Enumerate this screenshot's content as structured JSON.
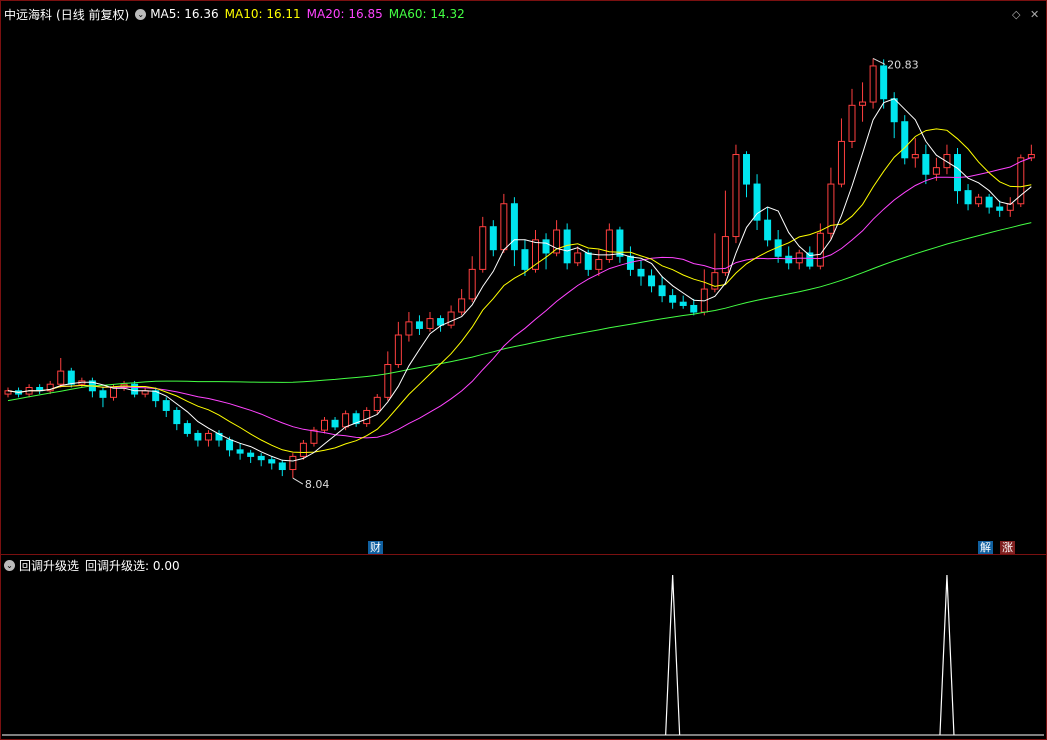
{
  "main_panel": {
    "stock_name": "中远海科",
    "period_label": "(日线 前复权)",
    "ma_items": [
      {
        "label": "MA5: 16.36",
        "color": "#ffffff"
      },
      {
        "label": "MA10: 16.11",
        "color": "#ffff00"
      },
      {
        "label": "MA20: 16.85",
        "color": "#ff44ff"
      },
      {
        "label": "MA60: 14.32",
        "color": "#44ff44"
      }
    ],
    "high_label": "20.83",
    "low_label": "8.04",
    "tags": {
      "cai": "财",
      "jie": "解",
      "zhang": "涨"
    },
    "window_icons": {
      "diamond": "◇",
      "close": "✕"
    }
  },
  "indicator_panel": {
    "name": "回调升级选",
    "value_label": "回调升级选: 0.00"
  },
  "colors": {
    "up": "#ff4040",
    "down": "#00e5ee",
    "ma5": "#ffffff",
    "ma10": "#ffff00",
    "ma20": "#ff44ff",
    "ma60": "#44ff44",
    "border": "#7a1010"
  },
  "chart_data": {
    "type": "candlestick",
    "price_range": [
      6.0,
      22.0
    ],
    "candles": [
      [
        10.6,
        10.7,
        10.8,
        10.5
      ],
      [
        10.7,
        10.6,
        10.8,
        10.5
      ],
      [
        10.6,
        10.8,
        10.9,
        10.5
      ],
      [
        10.8,
        10.7,
        10.9,
        10.6
      ],
      [
        10.7,
        10.9,
        11.0,
        10.6
      ],
      [
        10.9,
        11.3,
        11.7,
        10.8
      ],
      [
        11.3,
        10.9,
        11.4,
        10.8
      ],
      [
        10.9,
        11.0,
        11.1,
        10.8
      ],
      [
        11.0,
        10.7,
        11.1,
        10.5
      ],
      [
        10.7,
        10.5,
        10.8,
        10.2
      ],
      [
        10.5,
        10.8,
        10.9,
        10.4
      ],
      [
        10.8,
        10.9,
        11.0,
        10.7
      ],
      [
        10.9,
        10.6,
        11.0,
        10.5
      ],
      [
        10.6,
        10.7,
        10.8,
        10.5
      ],
      [
        10.7,
        10.4,
        10.8,
        10.2
      ],
      [
        10.4,
        10.1,
        10.5,
        9.9
      ],
      [
        10.1,
        9.7,
        10.2,
        9.5
      ],
      [
        9.7,
        9.4,
        9.8,
        9.3
      ],
      [
        9.4,
        9.2,
        9.5,
        9.0
      ],
      [
        9.2,
        9.4,
        9.5,
        9.0
      ],
      [
        9.4,
        9.2,
        9.5,
        9.0
      ],
      [
        9.2,
        8.9,
        9.3,
        8.7
      ],
      [
        8.9,
        8.8,
        9.1,
        8.6
      ],
      [
        8.8,
        8.7,
        8.9,
        8.5
      ],
      [
        8.7,
        8.6,
        8.8,
        8.4
      ],
      [
        8.6,
        8.5,
        8.7,
        8.3
      ],
      [
        8.5,
        8.3,
        8.6,
        8.1
      ],
      [
        8.3,
        8.7,
        8.8,
        8.04
      ],
      [
        8.7,
        9.1,
        9.2,
        8.6
      ],
      [
        9.1,
        9.5,
        9.6,
        9.0
      ],
      [
        9.5,
        9.8,
        9.9,
        9.4
      ],
      [
        9.8,
        9.6,
        9.9,
        9.5
      ],
      [
        9.6,
        10.0,
        10.1,
        9.5
      ],
      [
        10.0,
        9.7,
        10.1,
        9.6
      ],
      [
        9.7,
        10.1,
        10.2,
        9.6
      ],
      [
        10.1,
        10.5,
        10.6,
        10.0
      ],
      [
        10.5,
        11.5,
        11.9,
        10.4
      ],
      [
        11.5,
        12.4,
        12.8,
        11.4
      ],
      [
        12.4,
        12.8,
        13.1,
        12.2
      ],
      [
        12.8,
        12.6,
        13.0,
        12.4
      ],
      [
        12.6,
        12.9,
        13.1,
        12.5
      ],
      [
        12.9,
        12.7,
        13.0,
        12.5
      ],
      [
        12.7,
        13.1,
        13.3,
        12.6
      ],
      [
        13.1,
        13.5,
        13.8,
        13.0
      ],
      [
        13.5,
        14.4,
        14.8,
        13.4
      ],
      [
        14.4,
        15.7,
        16.0,
        14.3
      ],
      [
        15.7,
        15.0,
        15.9,
        14.8
      ],
      [
        15.0,
        16.4,
        16.7,
        14.9
      ],
      [
        16.4,
        15.0,
        16.6,
        14.5
      ],
      [
        15.0,
        14.4,
        15.3,
        14.2
      ],
      [
        14.4,
        15.3,
        15.6,
        14.3
      ],
      [
        15.3,
        14.9,
        15.5,
        14.4
      ],
      [
        14.9,
        15.6,
        15.9,
        14.8
      ],
      [
        15.6,
        14.6,
        15.8,
        14.4
      ],
      [
        14.6,
        14.9,
        15.1,
        14.5
      ],
      [
        14.9,
        14.4,
        15.0,
        14.2
      ],
      [
        14.4,
        14.7,
        15.0,
        14.2
      ],
      [
        14.7,
        15.6,
        15.8,
        14.6
      ],
      [
        15.6,
        14.8,
        15.7,
        14.6
      ],
      [
        14.8,
        14.4,
        15.1,
        14.2
      ],
      [
        14.4,
        14.2,
        14.7,
        13.9
      ],
      [
        14.2,
        13.9,
        14.4,
        13.7
      ],
      [
        13.9,
        13.6,
        14.2,
        13.4
      ],
      [
        13.6,
        13.4,
        13.8,
        13.2
      ],
      [
        13.4,
        13.3,
        13.6,
        13.2
      ],
      [
        13.3,
        13.1,
        13.5,
        13.0
      ],
      [
        13.1,
        13.8,
        14.4,
        13.0
      ],
      [
        13.8,
        14.3,
        15.5,
        13.7
      ],
      [
        14.3,
        15.4,
        16.8,
        14.2
      ],
      [
        15.4,
        17.9,
        18.2,
        15.2
      ],
      [
        17.9,
        17.0,
        18.0,
        16.6
      ],
      [
        17.0,
        15.9,
        17.3,
        15.6
      ],
      [
        15.9,
        15.3,
        16.3,
        15.1
      ],
      [
        15.3,
        14.8,
        15.6,
        14.6
      ],
      [
        14.8,
        14.6,
        15.1,
        14.4
      ],
      [
        14.6,
        14.9,
        15.0,
        14.4
      ],
      [
        14.9,
        14.5,
        15.1,
        14.4
      ],
      [
        14.5,
        15.5,
        15.8,
        14.4
      ],
      [
        15.5,
        17.0,
        17.5,
        15.3
      ],
      [
        17.0,
        18.3,
        19.0,
        16.9
      ],
      [
        18.3,
        19.4,
        19.9,
        18.1
      ],
      [
        19.4,
        19.5,
        20.1,
        18.9
      ],
      [
        19.5,
        20.6,
        20.83,
        19.3
      ],
      [
        20.6,
        19.6,
        20.8,
        19.3
      ],
      [
        19.6,
        18.9,
        19.8,
        18.4
      ],
      [
        18.9,
        17.8,
        19.1,
        17.6
      ],
      [
        17.8,
        17.9,
        18.4,
        17.5
      ],
      [
        17.9,
        17.3,
        18.2,
        17.0
      ],
      [
        17.3,
        17.5,
        17.8,
        17.1
      ],
      [
        17.5,
        17.9,
        18.2,
        17.3
      ],
      [
        17.9,
        16.8,
        18.1,
        16.4
      ],
      [
        16.8,
        16.4,
        17.0,
        16.2
      ],
      [
        16.4,
        16.6,
        16.7,
        16.3
      ],
      [
        16.6,
        16.3,
        16.7,
        16.1
      ],
      [
        16.3,
        16.2,
        16.5,
        16.0
      ],
      [
        16.2,
        16.4,
        16.6,
        16.0
      ],
      [
        16.4,
        17.8,
        17.9,
        16.3
      ],
      [
        17.8,
        17.9,
        18.2,
        17.7
      ]
    ],
    "indicator": {
      "name": "回调升级选",
      "value": 0.0,
      "spikes_at_index": [
        63,
        89
      ]
    }
  }
}
